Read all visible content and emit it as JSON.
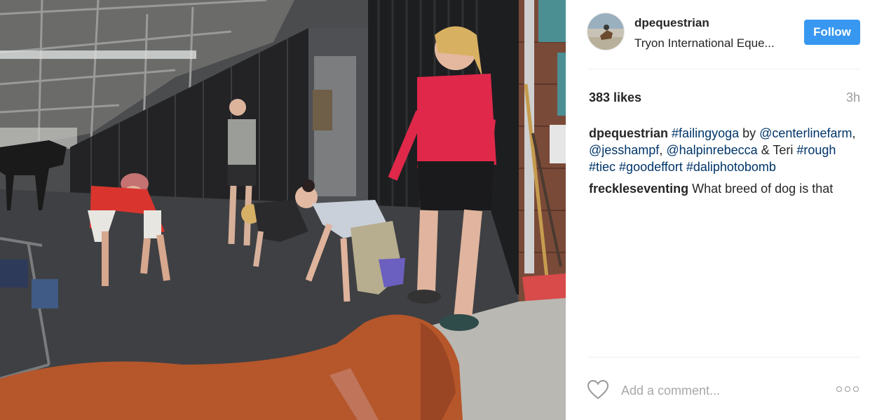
{
  "post": {
    "username": "dpequestrian",
    "location": "Tryon International Eque...",
    "follow_label": "Follow",
    "likes": "383 likes",
    "time": "3h",
    "add_comment_placeholder": "Add a comment..."
  },
  "caption": {
    "user": "dpequestrian",
    "parts": [
      {
        "text": "#failingyoga",
        "tag": true
      },
      {
        "text": " by ",
        "tag": false
      },
      {
        "text": "@centerlinefarm",
        "tag": true
      },
      {
        "text": ", ",
        "tag": false
      },
      {
        "text": "@jesshampf",
        "tag": true
      },
      {
        "text": ", ",
        "tag": false
      },
      {
        "text": "@halpinrebecca",
        "tag": true
      },
      {
        "text": " & Teri ",
        "tag": false
      },
      {
        "text": "#rough",
        "tag": true
      },
      {
        "text": " ",
        "tag": false
      },
      {
        "text": "#tiec",
        "tag": true
      },
      {
        "text": " ",
        "tag": false
      },
      {
        "text": "#goodeffort",
        "tag": true
      },
      {
        "text": " ",
        "tag": false
      },
      {
        "text": "#daliphotobomb",
        "tag": true
      }
    ]
  },
  "reply": {
    "user": "freckleseventing",
    "text": "What breed of dog is that"
  },
  "colors": {
    "follow_blue": "#3897f0",
    "link_blue": "#003569",
    "muted_gray": "#999999"
  },
  "icons": [
    "heart-icon",
    "more-options-icon"
  ]
}
